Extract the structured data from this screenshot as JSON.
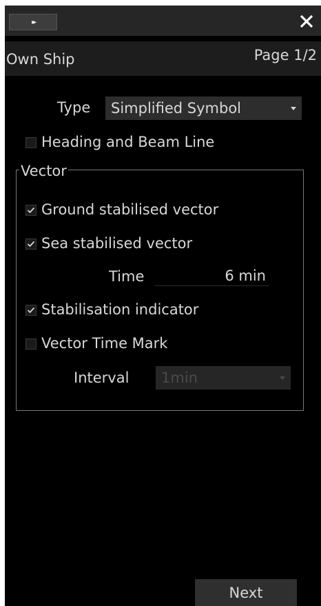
{
  "titlebar": {
    "forward_icon": "fast-forward-icon",
    "forward_glyph": "▸▸",
    "close_icon": "close-x-icon"
  },
  "header": {
    "title": "Own Ship",
    "page": "Page 1/2"
  },
  "type_setting": {
    "label": "Type",
    "selected": "Simplified Symbol"
  },
  "heading_beam_line": {
    "label": "Heading and Beam Line",
    "checked": false
  },
  "vector": {
    "legend": "Vector",
    "ground_stabilised": {
      "label": "Ground stabilised vector",
      "checked": true
    },
    "sea_stabilised": {
      "label": "Sea stabilised vector",
      "checked": true
    },
    "time": {
      "label": "Time",
      "value": "6 min"
    },
    "stabilisation_indicator": {
      "label": "Stabilisation indicator",
      "checked": true
    },
    "vector_time_mark": {
      "label": "Vector Time Mark",
      "checked": false
    },
    "interval": {
      "label": "Interval",
      "selected": "1min",
      "disabled": true
    }
  },
  "footer": {
    "next_label": "Next"
  },
  "colors": {
    "background": "#000000",
    "text": "#d8d8d8",
    "disabled_text": "#4a4a4a",
    "control_bg": "#2d2d2d"
  }
}
